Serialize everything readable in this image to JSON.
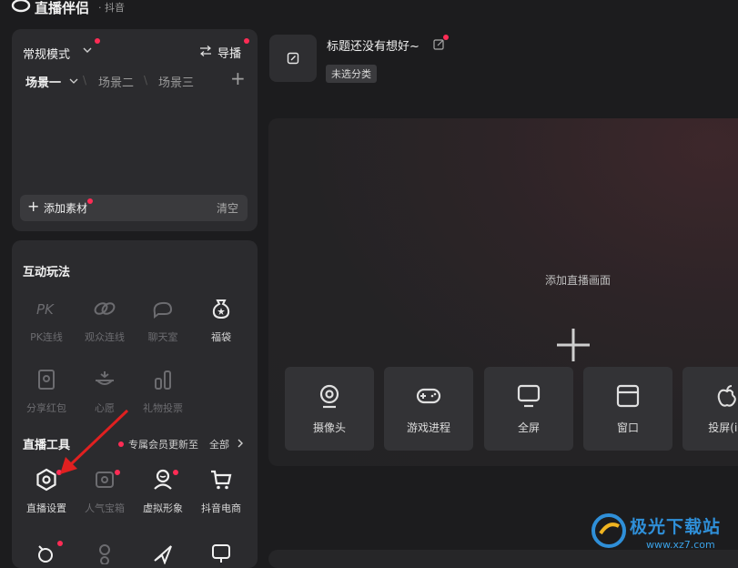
{
  "app": {
    "title": "直播伴侣",
    "subtitle": "· 抖音"
  },
  "scene": {
    "mode": "常规模式",
    "guide": "导播",
    "tabs": [
      "场景一",
      "场景二",
      "场景三"
    ],
    "add_material": "添加素材",
    "clear": "清空"
  },
  "interactive": {
    "title": "互动玩法",
    "items": [
      {
        "label": "PK连线",
        "icon": "pk-icon",
        "enabled": false
      },
      {
        "label": "观众连线",
        "icon": "link-icon",
        "enabled": false
      },
      {
        "label": "聊天室",
        "icon": "chat-room-icon",
        "enabled": false
      },
      {
        "label": "福袋",
        "icon": "lucky-bag-icon",
        "enabled": true
      },
      {
        "label": "分享红包",
        "icon": "red-packet-icon",
        "enabled": false
      },
      {
        "label": "心愿",
        "icon": "wish-icon",
        "enabled": false
      },
      {
        "label": "礼物投票",
        "icon": "gift-vote-icon",
        "enabled": false
      }
    ]
  },
  "tools": {
    "title": "直播工具",
    "member_news": "专属会员更新至",
    "all": "全部",
    "items": [
      {
        "label": "直播设置",
        "icon": "hexagon-settings-icon",
        "enabled": true
      },
      {
        "label": "人气宝箱",
        "icon": "treasure-box-icon",
        "enabled": false
      },
      {
        "label": "虚拟形象",
        "icon": "avatar-icon",
        "enabled": true
      },
      {
        "label": "抖音电商",
        "icon": "shopping-cart-icon",
        "enabled": true
      }
    ]
  },
  "header": {
    "live_title": "标题还没有想好~",
    "category": "未选分类"
  },
  "canvas": {
    "add_label": "添加直播画面",
    "sources": [
      {
        "label": "摄像头",
        "icon": "camera-icon"
      },
      {
        "label": "游戏进程",
        "icon": "gamepad-icon"
      },
      {
        "label": "全屏",
        "icon": "monitor-icon"
      },
      {
        "label": "窗口",
        "icon": "window-icon"
      },
      {
        "label": "投屏(iO",
        "icon": "apple-icon"
      }
    ]
  },
  "watermark": {
    "title": "极光下载站",
    "url": "www.xz7.com"
  },
  "colors": {
    "accent_dot": "#fe2c55",
    "annotation_arrow": "#e02020",
    "watermark_blue": "#2f8fd8"
  }
}
